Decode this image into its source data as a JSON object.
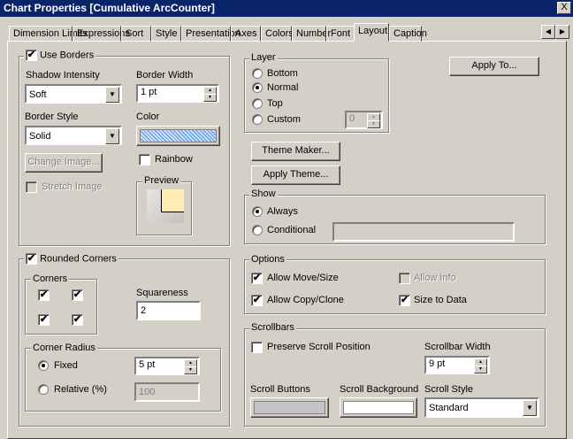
{
  "window": {
    "title": "Chart Properties [Cumulative ArcCounter]",
    "close": "X"
  },
  "tabs": [
    "Dimension Limits",
    "Expressions",
    "Sort",
    "Style",
    "Presentation",
    "Axes",
    "Colors",
    "Number",
    "Font",
    "Layout",
    "Caption"
  ],
  "tab_arrows": {
    "left": "◀",
    "right": "▶"
  },
  "borders": {
    "use_borders": "Use Borders",
    "use_borders_checked": true,
    "shadow_intensity_label": "Shadow Intensity",
    "shadow_intensity": "Soft",
    "border_width_label": "Border Width",
    "border_width": "1 pt",
    "border_style_label": "Border Style",
    "border_style": "Solid",
    "color_label": "Color",
    "rainbow": "Rainbow",
    "change_image": "Change Image...",
    "stretch_image": "Stretch Image",
    "preview": "Preview"
  },
  "rounded": {
    "rounded_corners": "Rounded Corners",
    "corners": "Corners",
    "squareness_label": "Squareness",
    "squareness": "2",
    "corner_radius": "Corner Radius",
    "fixed": "Fixed",
    "fixed_value": "5 pt",
    "relative": "Relative (%)",
    "relative_value": "100"
  },
  "layer": {
    "title": "Layer",
    "options": [
      "Bottom",
      "Normal",
      "Top",
      "Custom"
    ],
    "selected": "Normal",
    "custom_value": "0"
  },
  "buttons": {
    "apply_to": "Apply To...",
    "theme_maker": "Theme Maker...",
    "apply_theme": "Apply Theme..."
  },
  "show": {
    "title": "Show",
    "always": "Always",
    "conditional": "Conditional",
    "selected": "Always"
  },
  "options": {
    "title": "Options",
    "allow_move": "Allow Move/Size",
    "allow_copy": "Allow Copy/Clone",
    "allow_info": "Allow Info",
    "size_to_data": "Size to Data"
  },
  "scrollbars": {
    "title": "Scrollbars",
    "preserve": "Preserve Scroll Position",
    "width_label": "Scrollbar Width",
    "width": "9 pt",
    "buttons_label": "Scroll Buttons",
    "background_label": "Scroll Background",
    "style_label": "Scroll Style",
    "style": "Standard",
    "buttons_color": "#c4c4c8",
    "background_color": "#ffffff"
  },
  "glyphs": {
    "check": "✔",
    "down": "▼",
    "up_small": "▲",
    "down_small": "▼"
  }
}
